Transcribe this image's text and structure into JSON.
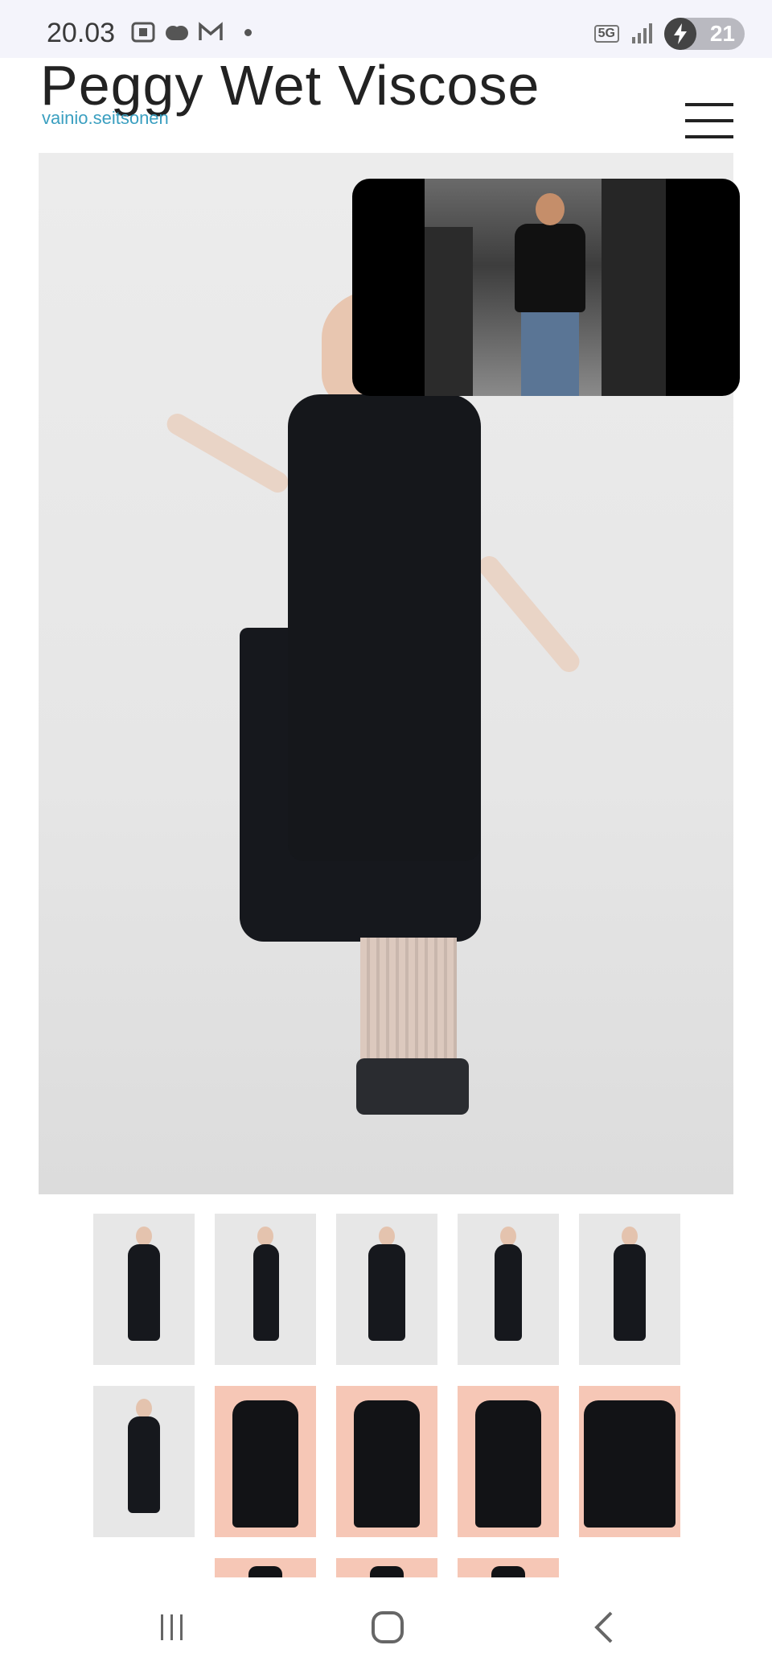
{
  "status_bar": {
    "time": "20.03",
    "network": "5G",
    "battery": "21",
    "icons": [
      "screenshot-icon",
      "cloud-icon",
      "gmail-icon",
      "notification-dot",
      "signal-icon",
      "battery-charging-icon"
    ]
  },
  "header": {
    "title": "Peggy Wet Viscose",
    "subtitle": "vainio.seitsonen",
    "menu_icon": "hamburger-menu-icon"
  },
  "main_image": {
    "alt": "back view of model in black dress"
  },
  "video_overlay": {
    "icon": "picture-in-picture-video"
  },
  "thumbnails": {
    "rows": [
      [
        {
          "kind": "model",
          "bg": "#e7e7e7"
        },
        {
          "kind": "model",
          "bg": "#e7e7e7"
        },
        {
          "kind": "model",
          "bg": "#e7e7e7"
        },
        {
          "kind": "model",
          "bg": "#e7e7e7"
        },
        {
          "kind": "model",
          "bg": "#e7e7e7"
        }
      ],
      [
        {
          "kind": "model",
          "bg": "#e7e7e7"
        },
        {
          "kind": "flat",
          "bg": "#f6c7b6"
        },
        {
          "kind": "flat",
          "bg": "#f6c7b6"
        },
        {
          "kind": "flat",
          "bg": "#f6c7b6"
        },
        {
          "kind": "flat",
          "bg": "#f6c7b6"
        }
      ],
      [
        {
          "kind": "flat",
          "bg": "#f6c7b6"
        },
        {
          "kind": "flat",
          "bg": "#f6c7b6"
        },
        {
          "kind": "flat",
          "bg": "#f6c7b6"
        }
      ]
    ]
  },
  "nav_bar": {
    "recent_icon": "recent-apps-icon",
    "home_icon": "home-icon",
    "back_icon": "back-icon"
  },
  "colors": {
    "accent": "#3a9fc0",
    "thumb_peach": "#f6c7b6",
    "dress": "#16181d"
  }
}
